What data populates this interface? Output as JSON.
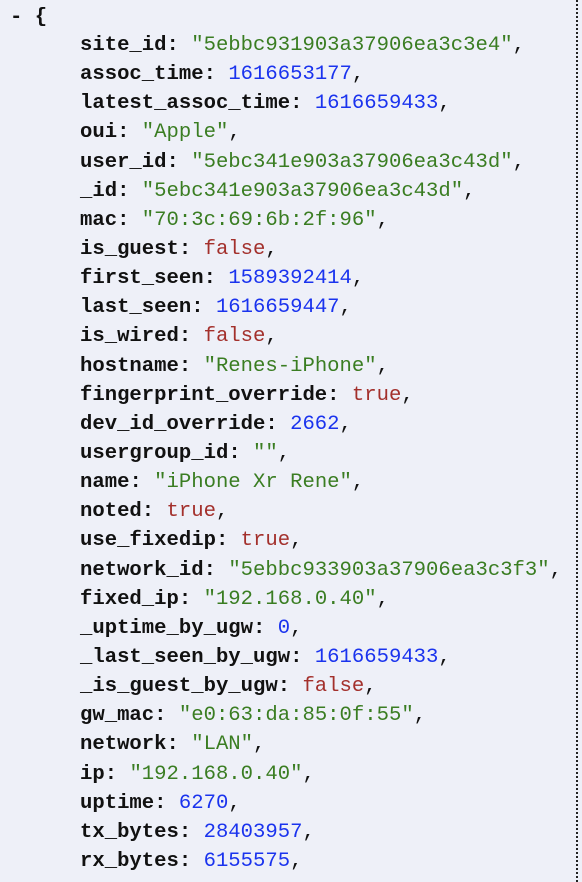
{
  "header": {
    "collapse_toggle": "-",
    "open_brace": "{"
  },
  "colors": {
    "background": "#eef0f8",
    "string": "#3a7d22",
    "number": "#1a33ee",
    "boolean": "#a3302c"
  },
  "entries": [
    {
      "key": "site_id",
      "value": "\"5ebbc931903a37906ea3c3e4\"",
      "type": "string"
    },
    {
      "key": "assoc_time",
      "value": "1616653177",
      "type": "number"
    },
    {
      "key": "latest_assoc_time",
      "value": "1616659433",
      "type": "number"
    },
    {
      "key": "oui",
      "value": "\"Apple\"",
      "type": "string"
    },
    {
      "key": "user_id",
      "value": "\"5ebc341e903a37906ea3c43d\"",
      "type": "string"
    },
    {
      "key": "_id",
      "value": "\"5ebc341e903a37906ea3c43d\"",
      "type": "string"
    },
    {
      "key": "mac",
      "value": "\"70:3c:69:6b:2f:96\"",
      "type": "string"
    },
    {
      "key": "is_guest",
      "value": "false",
      "type": "boolean"
    },
    {
      "key": "first_seen",
      "value": "1589392414",
      "type": "number"
    },
    {
      "key": "last_seen",
      "value": "1616659447",
      "type": "number"
    },
    {
      "key": "is_wired",
      "value": "false",
      "type": "boolean"
    },
    {
      "key": "hostname",
      "value": "\"Renes-iPhone\"",
      "type": "string"
    },
    {
      "key": "fingerprint_override",
      "value": "true",
      "type": "boolean"
    },
    {
      "key": "dev_id_override",
      "value": "2662",
      "type": "number"
    },
    {
      "key": "usergroup_id",
      "value": "\"\"",
      "type": "string"
    },
    {
      "key": "name",
      "value": "\"iPhone Xr Rene\"",
      "type": "string"
    },
    {
      "key": "noted",
      "value": "true",
      "type": "boolean"
    },
    {
      "key": "use_fixedip",
      "value": "true",
      "type": "boolean"
    },
    {
      "key": "network_id",
      "value": "\"5ebbc933903a37906ea3c3f3\"",
      "type": "string"
    },
    {
      "key": "fixed_ip",
      "value": "\"192.168.0.40\"",
      "type": "string"
    },
    {
      "key": "_uptime_by_ugw",
      "value": "0",
      "type": "number"
    },
    {
      "key": "_last_seen_by_ugw",
      "value": "1616659433",
      "type": "number"
    },
    {
      "key": "_is_guest_by_ugw",
      "value": "false",
      "type": "boolean"
    },
    {
      "key": "gw_mac",
      "value": "\"e0:63:da:85:0f:55\"",
      "type": "string"
    },
    {
      "key": "network",
      "value": "\"LAN\"",
      "type": "string"
    },
    {
      "key": "ip",
      "value": "\"192.168.0.40\"",
      "type": "string"
    },
    {
      "key": "uptime",
      "value": "6270",
      "type": "number"
    },
    {
      "key": "tx_bytes",
      "value": "28403957",
      "type": "number"
    },
    {
      "key": "rx_bytes",
      "value": "6155575",
      "type": "number"
    }
  ]
}
